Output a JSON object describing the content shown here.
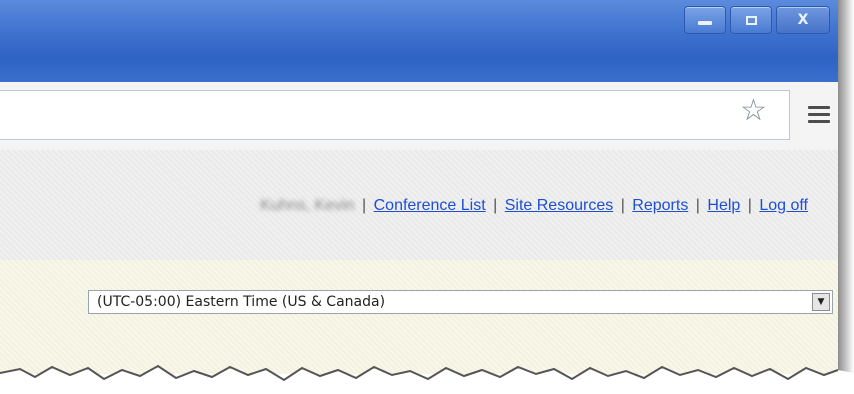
{
  "window": {
    "minimize_label": "",
    "maximize_label": "",
    "close_label": "X"
  },
  "toolbar": {
    "star_icon": "star-icon",
    "menu_icon": "hamburger-menu-icon"
  },
  "header": {
    "user_name": "Kuhns, Kevin",
    "separator": "|",
    "links": [
      "Conference List",
      "Site Resources",
      "Reports",
      "Help",
      "Log off"
    ]
  },
  "timezone": {
    "selected": "(UTC-05:00) Eastern Time (US & Canada)"
  },
  "colors": {
    "titlebar": "#3f72cf",
    "link": "#1e4fd3",
    "header_bg": "#e9e9e9",
    "content_bg": "#f4f2df"
  }
}
